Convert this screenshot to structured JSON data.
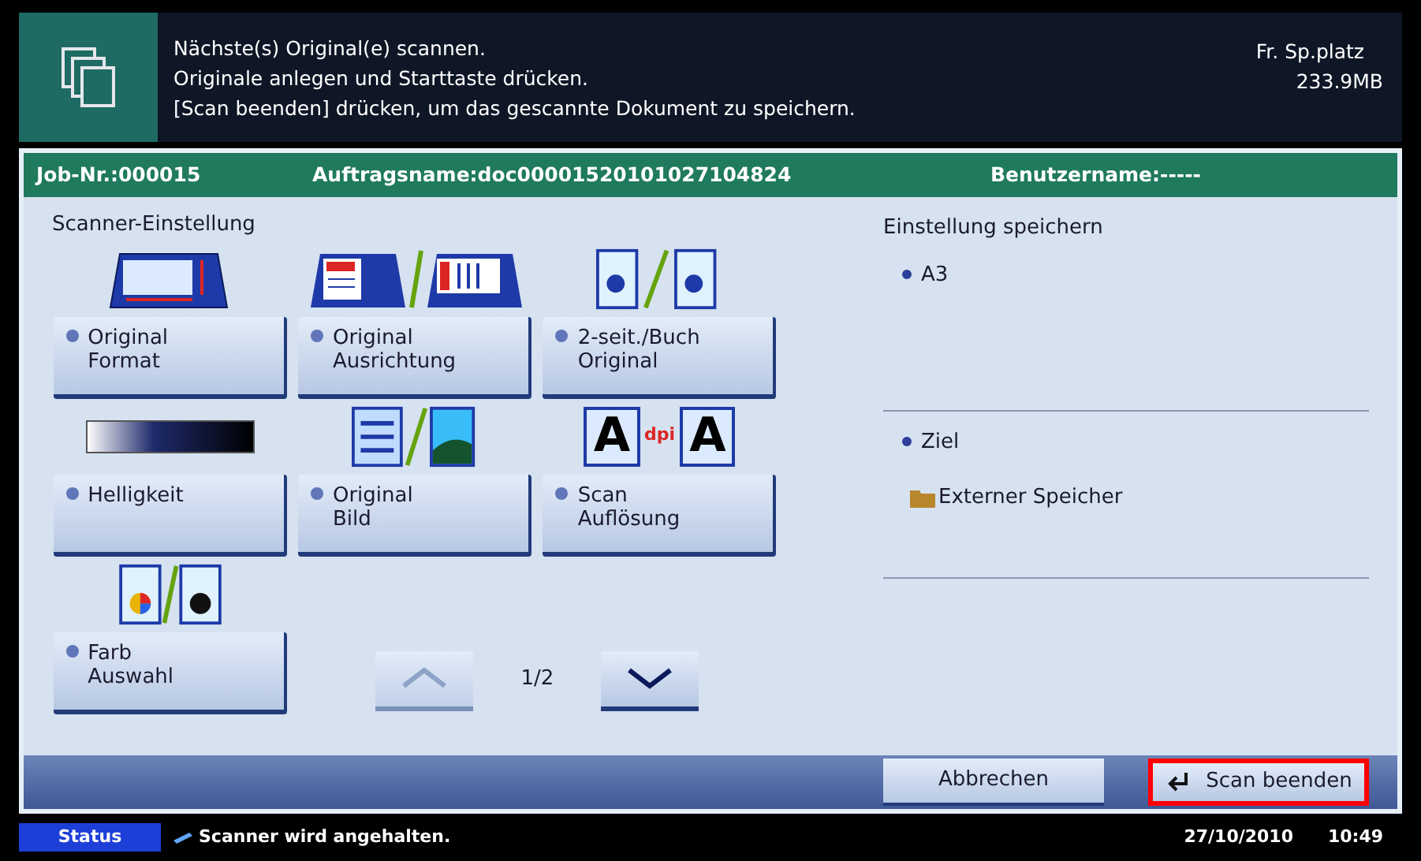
{
  "header": {
    "messages": [
      "Nächste(s) Original(e) scannen.",
      "Originale anlegen und Starttaste drücken.",
      "[Scan beenden] drücken, um das gescannte Dokument zu speichern."
    ],
    "free_space_label": "Fr. Sp.platz",
    "free_space_value": "233.9MB"
  },
  "job_bar": {
    "job_number": "Job-Nr.:000015",
    "job_name": "Auftragsname:doc00001520101027104824",
    "user_name": "Benutzername:-----"
  },
  "settings": {
    "title": "Scanner-Einstellung",
    "buttons": [
      {
        "kind": "format",
        "label": "Original\nFormat"
      },
      {
        "kind": "orientation",
        "label": "Original\nAusrichtung"
      },
      {
        "kind": "duplex",
        "label": "2-seit./Buch\nOriginal"
      },
      {
        "kind": "brightness",
        "label": "Helligkeit"
      },
      {
        "kind": "image",
        "label": "Original\nBild"
      },
      {
        "kind": "resolution",
        "label": "Scan\nAuflösung",
        "icon_texts": [
          "A",
          "dpi",
          "A"
        ]
      },
      {
        "kind": "color",
        "label": "Farb\nAuswahl"
      }
    ],
    "page": "1/2"
  },
  "saved_settings": {
    "title": "Einstellung speichern",
    "sections": [
      {
        "label": "A3"
      },
      {
        "label": "Ziel",
        "value": "Externer Speicher"
      }
    ]
  },
  "actions": [
    {
      "label": "Abbrechen",
      "highlighted": false,
      "kind": "cancel"
    },
    {
      "label": "Scan beenden",
      "highlighted": true,
      "kind": "enter"
    }
  ],
  "status_bar": {
    "button": "Status",
    "message": "Scanner wird angehalten.",
    "date": "27/10/2010",
    "time": "10:49"
  }
}
